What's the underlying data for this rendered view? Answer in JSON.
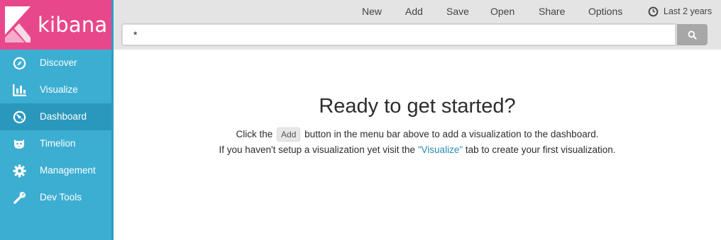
{
  "brand": {
    "name": "kibana",
    "logo_color": "#e8488b"
  },
  "sidebar": {
    "background": "#3caed2",
    "active_background": "#2a98bd",
    "items": [
      {
        "label": "Discover",
        "icon": "compass-icon",
        "active": false
      },
      {
        "label": "Visualize",
        "icon": "bar-chart-icon",
        "active": false
      },
      {
        "label": "Dashboard",
        "icon": "gauge-icon",
        "active": true
      },
      {
        "label": "Timelion",
        "icon": "timelion-icon",
        "active": false
      },
      {
        "label": "Management",
        "icon": "gear-icon",
        "active": false
      },
      {
        "label": "Dev Tools",
        "icon": "wrench-icon",
        "active": false
      }
    ]
  },
  "toolbar": {
    "new_label": "New",
    "add_label": "Add",
    "save_label": "Save",
    "open_label": "Open",
    "share_label": "Share",
    "options_label": "Options",
    "time_label": "Last 2 years",
    "time_icon": "clock-icon"
  },
  "search": {
    "value": "*",
    "button_icon": "search-icon"
  },
  "empty_state": {
    "headline": "Ready to get started?",
    "line1_before": "Click the",
    "line1_key": "Add",
    "line1_after": "button in the menu bar above to add a visualization to the dashboard.",
    "line2_before": "If you haven't setup a visualization yet visit the",
    "line2_link": "\"Visualize\"",
    "line2_after": "tab to create your first visualization.",
    "link_color": "#2a8bb1"
  }
}
